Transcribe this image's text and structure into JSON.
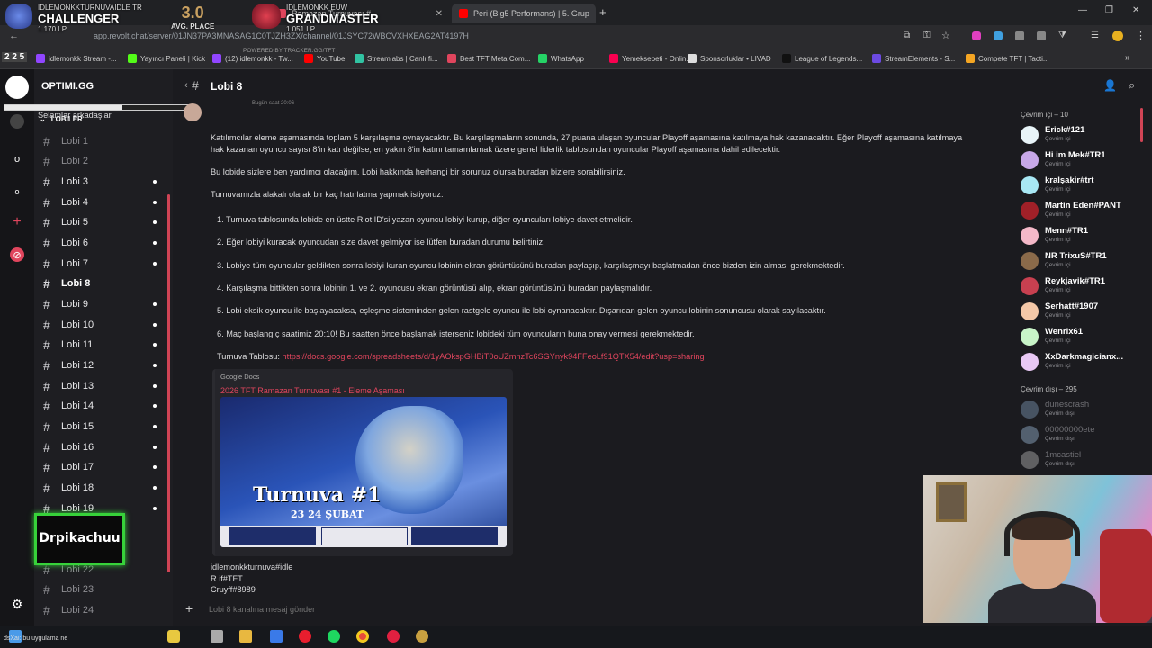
{
  "stream_overlay": {
    "rank1": {
      "title": "CHALLENGER",
      "player": "IDLEMONKKTURNUVAIDLE",
      "region": "TR",
      "lp": "1.170 LP"
    },
    "avg_place": {
      "value": "3.0",
      "label": "AVG. PLACE"
    },
    "rank2": {
      "title": "GRANDMASTER",
      "player": "IDLEMONKK",
      "region": "EUW",
      "lp": "1.051 LP"
    },
    "powered_by": "POWERED BY TRACKER.GG/TFT",
    "record": "2 2 5",
    "sub_alert": "Drpikachuu",
    "bottom_note": "dsXai: bu uygulama ne"
  },
  "browser": {
    "tabs": [
      {
        "label": "Ramazan Turnuvası #",
        "color": "#e0455d"
      },
      {
        "label": "Peri (Big5 Performans) | 5. Grup",
        "color": "#ff0000"
      }
    ],
    "url": "app.revolt.chat/server/01JN37PA3MNASAG1C0TJZH3ZX/channel/01JSYC72WBCVXHXEAG2AT4197H",
    "bookmarks": [
      {
        "label": "idlemonkk Stream -...",
        "color": "#9146ff"
      },
      {
        "label": "Yayıncı Paneli | Kick",
        "color": "#53fc18"
      },
      {
        "label": "(12) idlemonkk - Tw...",
        "color": "#9146ff"
      },
      {
        "label": "YouTube",
        "color": "#ff0000"
      },
      {
        "label": "Streamlabs | Canlı fi...",
        "color": "#31c3a2"
      },
      {
        "label": "Best TFT Meta Com...",
        "color": "#e0455d"
      },
      {
        "label": "WhatsApp",
        "color": "#25d366"
      },
      {
        "label": "Yemeksepeti - Onlin...",
        "color": "#fa0050"
      },
      {
        "label": "Sponsorluklar • LIVAD",
        "color": "#dddddd"
      },
      {
        "label": "League of Legends...",
        "color": "#111111"
      },
      {
        "label": "StreamElements - S...",
        "color": "#6c4ae2"
      },
      {
        "label": "Compete TFT | Tacti...",
        "color": "#f5a623"
      }
    ]
  },
  "server": {
    "name": "OPTIMI.GG",
    "category": "LOBILER",
    "channels": [
      {
        "name": "Lobi 1",
        "muted": true,
        "unread": false
      },
      {
        "name": "Lobi 2",
        "muted": true,
        "unread": false
      },
      {
        "name": "Lobi 3",
        "muted": false,
        "unread": true
      },
      {
        "name": "Lobi 4",
        "muted": false,
        "unread": true
      },
      {
        "name": "Lobi 5",
        "muted": false,
        "unread": true
      },
      {
        "name": "Lobi 6",
        "muted": false,
        "unread": true
      },
      {
        "name": "Lobi 7",
        "muted": false,
        "unread": true
      },
      {
        "name": "Lobi 8",
        "muted": false,
        "unread": false
      },
      {
        "name": "Lobi 9",
        "muted": false,
        "unread": true
      },
      {
        "name": "Lobi 10",
        "muted": false,
        "unread": true
      },
      {
        "name": "Lobi 11",
        "muted": false,
        "unread": true
      },
      {
        "name": "Lobi 12",
        "muted": false,
        "unread": true
      },
      {
        "name": "Lobi 13",
        "muted": false,
        "unread": true
      },
      {
        "name": "Lobi 14",
        "muted": false,
        "unread": true
      },
      {
        "name": "Lobi 15",
        "muted": false,
        "unread": true
      },
      {
        "name": "Lobi 16",
        "muted": false,
        "unread": true
      },
      {
        "name": "Lobi 17",
        "muted": false,
        "unread": true
      },
      {
        "name": "Lobi 18",
        "muted": false,
        "unread": true
      },
      {
        "name": "Lobi 19",
        "muted": false,
        "unread": true
      },
      {
        "name": "Lobi 22",
        "muted": true,
        "unread": false
      },
      {
        "name": "Lobi 23",
        "muted": true,
        "unread": false
      },
      {
        "name": "Lobi 24",
        "muted": true,
        "unread": false
      }
    ]
  },
  "channel": {
    "title": "Lobi 8"
  },
  "message": {
    "timestamp": "Bugün saat 20:06",
    "greeting": "Selamlar arkadaşlar.",
    "para1": "Katılımcılar eleme aşamasında toplam 5 karşılaşma oynayacaktır. Bu karşılaşmaların sonunda, 27 puana ulaşan oyuncular Playoff aşamasına katılmaya hak kazanacaktır. Eğer Playoff aşamasına katılmaya hak kazanan oyuncu sayısı 8'in katı değilse, en yakın 8'in katını tamamlamak üzere genel liderlik tablosundan oyuncular Playoff aşamasına dahil edilecektir.",
    "para2": "Bu lobide sizlere ben yardımcı olacağım. Lobi hakkında herhangi bir sorunuz olursa buradan bizlere sorabilirsiniz.",
    "para3": "Turnuvamızla alakalı olarak bir kaç hatırlatma yapmak istiyoruz:",
    "items": [
      "1. Turnuva tablosunda lobide en üstte Riot ID'si yazan oyuncu lobiyi kurup, diğer oyuncuları lobiye davet etmelidir.",
      "2. Eğer lobiyi kuracak oyuncudan size davet gelmiyor ise lütfen buradan durumu belirtiniz.",
      "3. Lobiye tüm oyuncular geldikten sonra lobiyi kuran oyuncu lobinin ekran görüntüsünü buradan paylaşıp, karşılaşmayı başlatmadan önce bizden izin alması gerekmektedir.",
      "4. Karşılaşma bittikten sonra lobinin 1. ve 2. oyuncusu ekran görüntüsü alıp, ekran görüntüsünü buradan paylaşmalıdır.",
      "5. Lobi eksik oyuncu ile başlayacaksa, eşleşme sisteminden gelen rastgele oyuncu ile lobi oynanacaktır. Dışarıdan gelen oyuncu lobinin sonuncusu olarak sayılacaktır.",
      "6. Maç başlangıç saatimiz 20:10! Bu saatten önce başlamak isterseniz lobideki tüm oyuncuların buna onay vermesi gerekmektedir."
    ],
    "table_label": "Turnuva Tablosu:",
    "table_link": "https://docs.google.com/spreadsheets/d/1yAOkspGHBiT0oUZmnzTc6SGYnyk94FFeoLf91QTX54/edit?usp=sharing",
    "embed": {
      "source": "Google Docs",
      "title": "2026 TFT Ramazan Turnuvası #1 - Eleme Aşaması",
      "image_title": "Turnuva #1",
      "image_date": "23 24 ŞUBAT"
    },
    "players": [
      "idlemonkkturnuva#idle",
      "R if#TFT",
      "Cruyff#8989"
    ]
  },
  "composer": {
    "placeholder": "Lobi 8 kanalına mesaj gönder"
  },
  "members": {
    "online_header": "Çevrim içi – 10",
    "offline_header": "Çevrim dışı – 295",
    "status_online": "Çevrim içi",
    "status_offline": "Çevrim dışı",
    "online": [
      {
        "name": "Erick#121",
        "color": "#e8f4f8"
      },
      {
        "name": "Hi im Mek#TR1",
        "color": "#c8a8e8"
      },
      {
        "name": "kralşakir#trt",
        "color": "#a8e8f4"
      },
      {
        "name": "Martin Eden#PANT",
        "color": "#a02028"
      },
      {
        "name": "Menn#TR1",
        "color": "#f4b8c8"
      },
      {
        "name": "NR TrixuS#TR1",
        "color": "#8a6a4a"
      },
      {
        "name": "Reykjavik#TR1",
        "color": "#c84050"
      },
      {
        "name": "Serhatt#1907",
        "color": "#f4c8a8"
      },
      {
        "name": "Wenrix61",
        "color": "#c8f4c8"
      },
      {
        "name": "XxDarkmagicianx...",
        "color": "#e8c8f4"
      }
    ],
    "offline": [
      {
        "name": "dunescrash",
        "color": "#8aa8c8"
      },
      {
        "name": "00000000ete",
        "color": "#a8c8e8"
      },
      {
        "name": "1mcastiel",
        "color": "#c8c8c8"
      }
    ]
  }
}
